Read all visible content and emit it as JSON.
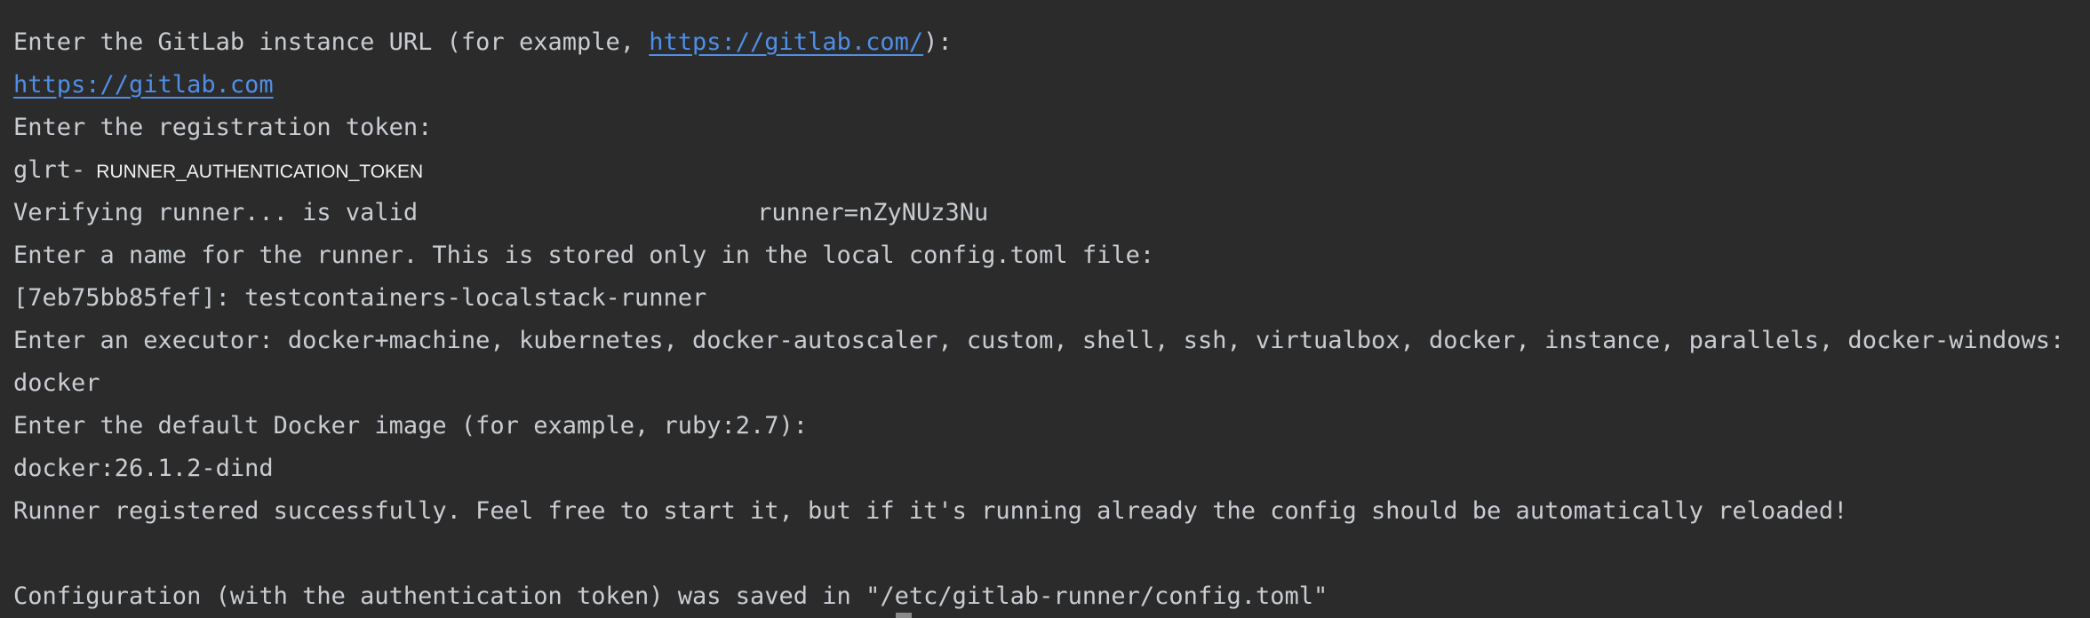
{
  "terminal": {
    "line_1_prefix": "Enter the GitLab instance URL (for example, ",
    "line_1_link": "https://gitlab.com/",
    "line_1_suffix": "):",
    "line_2_link": "https://gitlab.com",
    "line_3": "Enter the registration token:",
    "line_4_prefix": "glrt-",
    "line_4_token": "RUNNER_AUTHENTICATION_TOKEN",
    "line_5_status": "Verifying runner... is valid",
    "line_5_runner": "runner=nZyNUz3Nu",
    "line_6": "Enter a name for the runner. This is stored only in the local config.toml file:",
    "line_7": "[7eb75bb85fef]: testcontainers-localstack-runner",
    "line_8": "Enter an executor: docker+machine, kubernetes, docker-autoscaler, custom, shell, ssh, virtualbox, docker, instance, parallels, docker-windows:",
    "line_9": "docker",
    "line_10": "Enter the default Docker image (for example, ruby:2.7):",
    "line_11": "docker:26.1.2-dind",
    "line_12": "Runner registered successfully. Feel free to start it, but if it's running already the config should be automatically reloaded!",
    "line_13": "",
    "line_14": "Configuration (with the authentication token) was saved in \"/etc/gitlab-runner/config.toml\""
  },
  "colors": {
    "background": "#2b2b2b",
    "text": "#c9cdd2",
    "link": "#4f8fe6"
  }
}
